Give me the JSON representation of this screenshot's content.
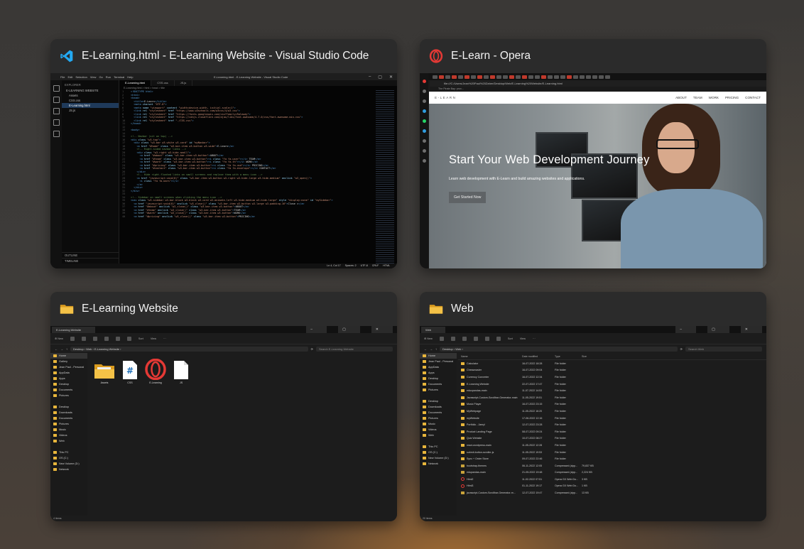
{
  "windows": [
    {
      "title": "E-Learning.html - E-Learning Website - Visual Studio Code",
      "app": "vscode",
      "icon": "vscode-icon",
      "vscode": {
        "window_title": "E-Learning.html - E-Learning Website - Visual Studio Code",
        "menus": [
          "File",
          "Edit",
          "Selection",
          "View",
          "Go",
          "Run",
          "Terminal",
          "Help"
        ],
        "explorer_header": "EXPLORER",
        "explorer_root": "E-LEARNING WEBSITE",
        "files": [
          "Assets",
          "CSS.css",
          "E-Learning.html",
          "JS.js"
        ],
        "bottom_sections": [
          "OUTLINE",
          "TIMELINE"
        ],
        "tabs": [
          "E-Learning.html",
          "CSS.css",
          "JS.js"
        ],
        "breadcrumb": "E-Learning.html > html > head > title",
        "status": [
          "Ln 4, Col 17",
          "Spaces: 2",
          "UTF-8",
          "CRLF",
          "HTML"
        ],
        "code_lines": [
          {
            "n": "1",
            "html": "<span class='t'>&lt;!DOCTYPE html&gt;</span>"
          },
          {
            "n": "2",
            "html": "<span class='t'>&lt;html&gt;</span>"
          },
          {
            "n": "3",
            "html": "<span class='t'>&lt;head&gt;</span>"
          },
          {
            "n": "4",
            "html": "  <span class='t'>&lt;title&gt;</span><span class='x'>E-Learn</span><span class='t'>&lt;/title&gt;</span>"
          },
          {
            "n": "5",
            "html": "  <span class='t'>&lt;meta</span> <span class='a'>charset</span>=<span class='s'>\"UTF-8\"</span><span class='t'>&gt;</span>"
          },
          {
            "n": "6",
            "html": "  <span class='t'>&lt;meta</span> <span class='a'>name</span>=<span class='s'>\"viewport\"</span> <span class='a'>content</span>=<span class='s'>\"width=device-width, initial-scale=1\"</span><span class='t'>&gt;</span>"
          },
          {
            "n": "7",
            "html": "  <span class='t'>&lt;link</span> <span class='a'>rel</span>=<span class='s'>\"stylesheet\"</span> <span class='a'>href</span>=<span class='s'>\"https://www.w3schools.com/w3css/4/w3.css\"</span><span class='t'>&gt;</span>"
          },
          {
            "n": "8",
            "html": "  <span class='t'>&lt;link</span> <span class='a'>rel</span>=<span class='s'>\"stylesheet\"</span> <span class='a'>href</span>=<span class='s'>\"https://fonts.googleapis.com/css?family=Raleway\"</span><span class='t'>&gt;</span>"
          },
          {
            "n": "9",
            "html": "  <span class='t'>&lt;link</span> <span class='a'>rel</span>=<span class='s'>\"stylesheet\"</span> <span class='a'>href</span>=<span class='s'>\"https://cdnjs.cloudflare.com/ajax/libs/font-awesome/4.7.0/css/font-awesome.min.css\"</span><span class='t'>&gt;</span>"
          },
          {
            "n": "10",
            "html": "  <span class='t'>&lt;link</span> <span class='a'>rel</span>=<span class='s'>\"stylesheet\"</span> <span class='a'>href</span>=<span class='s'>\"./CSS.css\"</span><span class='t'>&gt;</span>"
          },
          {
            "n": "11",
            "html": "<span class='t'>&lt;/head&gt;</span>"
          },
          {
            "n": "12",
            "html": ""
          },
          {
            "n": "13",
            "html": "<span class='t'>&lt;body&gt;</span>"
          },
          {
            "n": "14",
            "html": ""
          },
          {
            "n": "15",
            "html": "<span class='c'>&lt;!-- Navbar (sit on top) --&gt;</span>"
          },
          {
            "n": "16",
            "html": "<span class='t'>&lt;div</span> <span class='a'>class</span>=<span class='s'>\"w3-top\"</span><span class='t'>&gt;</span>"
          },
          {
            "n": "17",
            "html": "  <span class='t'>&lt;div</span> <span class='a'>class</span>=<span class='s'>\"w3-bar w3-white w3-card\"</span> <span class='a'>id</span>=<span class='s'>\"myNavbar\"</span><span class='t'>&gt;</span>"
          },
          {
            "n": "18",
            "html": "    <span class='t'>&lt;a</span> <span class='a'>href</span>=<span class='s'>\"#home\"</span> <span class='a'>class</span>=<span class='s'>\"w3-bar-item w3-button w3-wide\"</span><span class='t'>&gt;</span><span class='x'>E-Learn</span><span class='t'>&lt;/a&gt;</span>"
          },
          {
            "n": "19",
            "html": "    <span class='c'>&lt;!-- Right-sided navbar links --&gt;</span>"
          },
          {
            "n": "20",
            "html": "    <span class='t'>&lt;div</span> <span class='a'>class</span>=<span class='s'>\"w3-right w3-hide-small\"</span><span class='t'>&gt;</span>"
          },
          {
            "n": "21",
            "html": "      <span class='t'>&lt;a</span> <span class='a'>href</span>=<span class='s'>\"#about\"</span> <span class='a'>class</span>=<span class='s'>\"w3-bar-item w3-button\"</span><span class='t'>&gt;</span><span class='x'>ABOUT</span><span class='t'>&lt;/a&gt;</span>"
          },
          {
            "n": "22",
            "html": "      <span class='t'>&lt;a</span> <span class='a'>href</span>=<span class='s'>\"#team\"</span> <span class='a'>class</span>=<span class='s'>\"w3-bar-item w3-button\"</span><span class='t'>&gt;&lt;i</span> <span class='a'>class</span>=<span class='s'>\"fa fa-user\"</span><span class='t'>&gt;&lt;/i&gt;</span><span class='x'> TEAM</span><span class='t'>&lt;/a&gt;</span>"
          },
          {
            "n": "23",
            "html": "      <span class='t'>&lt;a</span> <span class='a'>href</span>=<span class='s'>\"#work\"</span> <span class='a'>class</span>=<span class='s'>\"w3-bar-item w3-button\"</span><span class='t'>&gt;&lt;i</span> <span class='a'>class</span>=<span class='s'>\"fa fa-th\"</span><span class='t'>&gt;&lt;/i&gt;</span><span class='x'> WORK</span><span class='t'>&lt;/a&gt;</span>"
          },
          {
            "n": "24",
            "html": "      <span class='t'>&lt;a</span> <span class='a'>href</span>=<span class='s'>\"#pricing\"</span> <span class='a'>class</span>=<span class='s'>\"w3-bar-item w3-button\"</span><span class='t'>&gt;&lt;i</span> <span class='a'>class</span>=<span class='s'>\"fa fa-usd\"</span><span class='t'>&gt;&lt;/i&gt;</span><span class='x'> PRICING</span><span class='t'>&lt;/a&gt;</span>"
          },
          {
            "n": "25",
            "html": "      <span class='t'>&lt;a</span> <span class='a'>href</span>=<span class='s'>\"#contact\"</span> <span class='a'>class</span>=<span class='s'>\"w3-bar-item w3-button\"</span><span class='t'>&gt;&lt;i</span> <span class='a'>class</span>=<span class='s'>\"fa fa-envelope\"</span><span class='t'>&gt;&lt;/i&gt;</span><span class='x'> CONTACT</span><span class='t'>&lt;/a&gt;</span>"
          },
          {
            "n": "26",
            "html": "    <span class='t'>&lt;/div&gt;</span>"
          },
          {
            "n": "27",
            "html": "    <span class='c'>&lt;!-- Hide right-floated links on small screens and replace them with a menu icon --&gt;</span>"
          },
          {
            "n": "28",
            "html": "    <span class='t'>&lt;a</span> <span class='a'>href</span>=<span class='s'>\"javascript:void(0)\"</span> <span class='a'>class</span>=<span class='s'>\"w3-bar-item w3-button w3-right w3-hide-large w3-hide-medium\"</span> <span class='a'>onclick</span>=<span class='s'>\"w3_open()\"</span><span class='t'>&gt;</span>"
          },
          {
            "n": "29",
            "html": "      <span class='t'>&lt;i</span> <span class='a'>class</span>=<span class='s'>\"fa fa-bars\"</span><span class='t'>&gt;&lt;/i&gt;</span>"
          },
          {
            "n": "30",
            "html": "    <span class='t'>&lt;/a&gt;</span>"
          },
          {
            "n": "31",
            "html": "  <span class='t'>&lt;/div&gt;</span>"
          },
          {
            "n": "32",
            "html": "<span class='t'>&lt;/div&gt;</span>"
          },
          {
            "n": "33",
            "html": ""
          },
          {
            "n": "34",
            "html": "<span class='c'>&lt;!-- Sidebar on small screens when clicking the menu icon --&gt;</span>"
          },
          {
            "n": "35",
            "html": "<span class='t'>&lt;nav</span> <span class='a'>class</span>=<span class='s'>\"w3-sidebar w3-bar-block w3-black w3-card w3-animate-left w3-hide-medium w3-hide-large\"</span> <span class='a'>style</span>=<span class='s'>\"display:none\"</span> <span class='a'>id</span>=<span class='s'>\"mySidebar\"</span><span class='t'>&gt;</span>"
          },
          {
            "n": "36",
            "html": "  <span class='t'>&lt;a</span> <span class='a'>href</span>=<span class='s'>\"javascript:void(0)\"</span> <span class='a'>onclick</span>=<span class='s'>\"w3_close()\"</span> <span class='a'>class</span>=<span class='s'>\"w3-bar-item w3-button w3-large w3-padding-16\"</span><span class='t'>&gt;</span><span class='x'>Close &times;</span><span class='t'>&lt;/a&gt;</span>"
          },
          {
            "n": "37",
            "html": "  <span class='t'>&lt;a</span> <span class='a'>href</span>=<span class='s'>\"#about\"</span> <span class='a'>onclick</span>=<span class='s'>\"w3_close()\"</span> <span class='a'>class</span>=<span class='s'>\"w3-bar-item w3-button\"</span><span class='t'>&gt;</span><span class='x'>ABOUT</span><span class='t'>&lt;/a&gt;</span>"
          },
          {
            "n": "38",
            "html": "  <span class='t'>&lt;a</span> <span class='a'>href</span>=<span class='s'>\"#team\"</span> <span class='a'>onclick</span>=<span class='s'>\"w3_close()\"</span> <span class='a'>class</span>=<span class='s'>\"w3-bar-item w3-button\"</span><span class='t'>&gt;</span><span class='x'>TEAM</span><span class='t'>&lt;/a&gt;</span>"
          },
          {
            "n": "39",
            "html": "  <span class='t'>&lt;a</span> <span class='a'>href</span>=<span class='s'>\"#work\"</span> <span class='a'>onclick</span>=<span class='s'>\"w3_close()\"</span> <span class='a'>class</span>=<span class='s'>\"w3-bar-item w3-button\"</span><span class='t'>&gt;</span><span class='x'>WORK</span><span class='t'>&lt;/a&gt;</span>"
          },
          {
            "n": "40",
            "html": "  <span class='t'>&lt;a</span> <span class='a'>href</span>=<span class='s'>\"#pricing\"</span> <span class='a'>onclick</span>=<span class='s'>\"w3_close()\"</span> <span class='a'>class</span>=<span class='s'>\"w3-bar-item w3-button\"</span><span class='t'>&gt;</span><span class='x'>PRICING</span><span class='t'>&lt;/a&gt;</span>"
          }
        ]
      }
    },
    {
      "title": "E-Learn - Opera",
      "app": "opera",
      "icon": "opera-icon",
      "opera": {
        "address": "file:///C:/Users/Jean%20Paul%20Zaher/Desktop/Web/E-Learning%20Website/E-Learning.html",
        "bookmark": "The Pirate Bay: prox...",
        "site_brand": "E-LEARN",
        "nav_links": [
          "ABOUT",
          "TEAM",
          "WORK",
          "PRICING",
          "CONTACT"
        ],
        "hero_title": "Start Your Web Development Journey",
        "hero_subtitle": "Learn web development with E-Learn and build amazing websites and applications.",
        "hero_button": "Get Started Now"
      }
    },
    {
      "title": "E-Learning Website",
      "app": "explorer",
      "icon": "folder-icon",
      "explorer": {
        "tab_title": "E-Learning Website",
        "new_label": "New",
        "sort_label": "Sort",
        "view_label": "View",
        "path": [
          "Desktop",
          "Web",
          "E-Learning Website"
        ],
        "search_placeholder": "Search E-Learning Website",
        "nav": [
          {
            "label": "Home",
            "sel": true
          },
          {
            "label": "Gallery"
          },
          {
            "label": "Jean Paul - Personal"
          },
          {
            "label": "AppData"
          },
          {
            "label": "Apps"
          },
          {
            "label": "Desktop"
          },
          {
            "label": "Documents"
          },
          {
            "label": "Pictures"
          },
          {
            "label": "gap"
          },
          {
            "label": "Desktop"
          },
          {
            "label": "Downloads"
          },
          {
            "label": "Documents"
          },
          {
            "label": "Pictures"
          },
          {
            "label": "Music"
          },
          {
            "label": "Videos"
          },
          {
            "label": "Web"
          },
          {
            "label": "gap"
          },
          {
            "label": "This PC"
          },
          {
            "label": "OS (C:)"
          },
          {
            "label": "New Volume (D:)"
          },
          {
            "label": "Network"
          }
        ],
        "items": [
          "Assets",
          "CSS",
          "E-Learning",
          "JS"
        ],
        "status": "4 items"
      }
    },
    {
      "title": "Web",
      "app": "explorer",
      "icon": "folder-icon",
      "explorer": {
        "tab_title": "Web",
        "new_label": "New",
        "sort_label": "Sort",
        "view_label": "View",
        "path": [
          "Desktop",
          "Web"
        ],
        "search_placeholder": "Search Web",
        "nav": [
          {
            "label": "Home",
            "sel": true
          },
          {
            "label": "Jean Paul - Personal"
          },
          {
            "label": "AppData"
          },
          {
            "label": "Apps"
          },
          {
            "label": "Desktop"
          },
          {
            "label": "Documents"
          },
          {
            "label": "Pictures"
          },
          {
            "label": "gap"
          },
          {
            "label": "Desktop"
          },
          {
            "label": "Downloads"
          },
          {
            "label": "Documents"
          },
          {
            "label": "Pictures"
          },
          {
            "label": "Music"
          },
          {
            "label": "Videos"
          },
          {
            "label": "Web"
          },
          {
            "label": "gap"
          },
          {
            "label": "This PC"
          },
          {
            "label": "OS (C:)"
          },
          {
            "label": "New Volume (D:)"
          },
          {
            "label": "Network"
          }
        ],
        "columns": [
          "Name",
          "Date modified",
          "Type",
          "Size"
        ],
        "rows": [
          {
            "name": "Calculator",
            "date": "16-07-2022 18:28",
            "type": "File folder",
            "size": "",
            "kind": "folder"
          },
          {
            "name": "Chessmaster",
            "date": "16-07-2022 09:04",
            "type": "File folder",
            "size": "",
            "kind": "folder"
          },
          {
            "name": "Currency Converter",
            "date": "16-07-2022 12:34",
            "type": "File folder",
            "size": "",
            "kind": "folder"
          },
          {
            "name": "E-Learning Website",
            "date": "22-07-2022 17:47",
            "type": "File folder",
            "size": "",
            "kind": "folder"
          },
          {
            "name": "educpandas-main",
            "date": "11-07-2022 14:53",
            "type": "File folder",
            "size": "",
            "kind": "folder"
          },
          {
            "name": "Javascript-Custom-Scrollbar-Generator-main",
            "date": "11-05-2022 19:51",
            "type": "File folder",
            "size": "",
            "kind": "folder"
          },
          {
            "name": "Music Player",
            "date": "16-07-2022 23:15",
            "type": "File folder",
            "size": "",
            "kind": "folder"
          },
          {
            "name": "MyWebpage",
            "date": "11-05-2022 16:20",
            "type": "File folder",
            "size": "",
            "kind": "folder"
          },
          {
            "name": "myWebsite",
            "date": "17-06-2022 12:16",
            "type": "File folder",
            "size": "",
            "kind": "folder"
          },
          {
            "name": "Portfolio - Jamyl",
            "date": "12-07-2022 23:28",
            "type": "File folder",
            "size": "",
            "kind": "folder"
          },
          {
            "name": "Product Landing Page",
            "date": "08-07-2022 09:24",
            "type": "File folder",
            "size": "",
            "kind": "folder"
          },
          {
            "name": "Quiz Website",
            "date": "10-07-2022 08:27",
            "type": "File folder",
            "size": "",
            "kind": "folder"
          },
          {
            "name": "react-wordpress-main",
            "date": "11-05-2022 12:28",
            "type": "File folder",
            "size": "",
            "kind": "folder"
          },
          {
            "name": "submit-button-scroller-js",
            "date": "11-05-2022 19:53",
            "type": "File folder",
            "size": "",
            "kind": "folder"
          },
          {
            "name": "Sync + Order Store",
            "date": "09-07-2022 22:46",
            "type": "File folder",
            "size": "",
            "kind": "folder"
          },
          {
            "name": "bootstrap-themes",
            "date": "06-11-2022 12:05",
            "type": "Compressed (zipp...",
            "size": "79,837 KB",
            "kind": "zip"
          },
          {
            "name": "edupandas-main",
            "date": "21-05-2022 19:48",
            "type": "Compressed (zipp...",
            "size": "2,224 KB",
            "kind": "zip"
          },
          {
            "name": "Html2",
            "date": "11-02-2022 07:51",
            "type": "Opera GX Web Do...",
            "size": "3 KB",
            "kind": "opera"
          },
          {
            "name": "Html3",
            "date": "01-11-2022 19:17",
            "type": "Opera GX Web Do...",
            "size": "1 KB",
            "kind": "opera"
          },
          {
            "name": "javascript-Custom-Scrollbar-Generator-m...",
            "date": "12-07-2022 19:47",
            "type": "Compressed (zipp...",
            "size": "13 KB",
            "kind": "zip"
          }
        ],
        "status": "20 items"
      }
    }
  ],
  "colors": {
    "vscode_blue": "#23a9f2",
    "opera_red": "#e53935",
    "folder_yellow": "#e7b53b"
  }
}
